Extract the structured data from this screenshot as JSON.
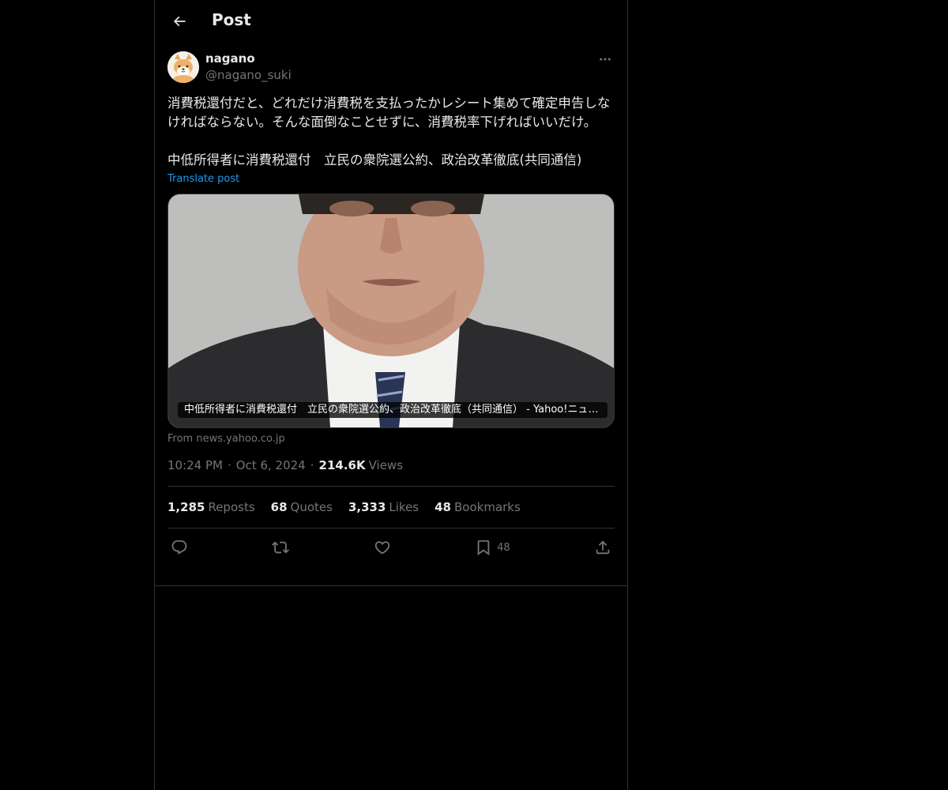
{
  "header": {
    "title": "Post"
  },
  "post": {
    "author": {
      "display_name": "nagano",
      "handle": "@nagano_suki"
    },
    "text": "消費税還付だと、どれだけ消費税を支払ったかレシート集めて確定申告しなければならない。そんな面倒なことせずに、消費税率下げればいいだけ。\n\n中低所得者に消費税還付　立民の衆院選公約、政治改革徹底(共同通信)",
    "translate_label": "Translate post",
    "card": {
      "caption": "中低所得者に消費税還付　立民の衆院選公約、政治改革徹底（共同通信） - Yahoo!ニュース",
      "source": "From news.yahoo.co.jp"
    },
    "meta": {
      "time": "10:24 PM",
      "date": "Oct 6, 2024",
      "views_count": "214.6K",
      "views_label": "Views"
    },
    "stats": {
      "reposts_count": "1,285",
      "reposts_label": "Reposts",
      "quotes_count": "68",
      "quotes_label": "Quotes",
      "likes_count": "3,333",
      "likes_label": "Likes",
      "bookmarks_count": "48",
      "bookmarks_label": "Bookmarks"
    },
    "actions": {
      "bookmark_count": "48"
    }
  },
  "icons": [
    "back-arrow-icon",
    "more-icon",
    "reply-icon",
    "repost-icon",
    "like-icon",
    "bookmark-icon",
    "share-icon"
  ],
  "colors": {
    "background": "#000000",
    "text": "#e7e9ea",
    "muted": "#71767b",
    "accent": "#1d9bf0",
    "border": "#2f3336"
  }
}
